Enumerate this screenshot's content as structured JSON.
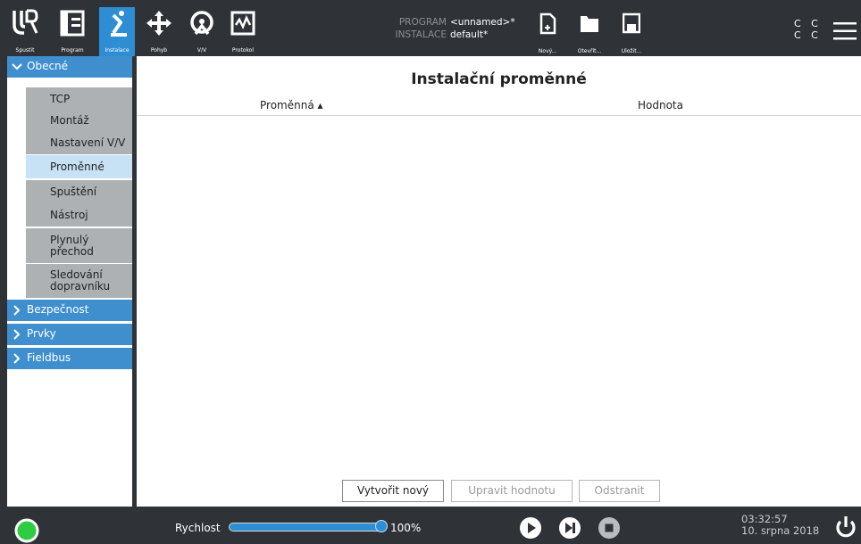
{
  "topbar": {
    "nav": [
      {
        "label": "Spustit",
        "icon": "ur-logo-icon"
      },
      {
        "label": "Program",
        "icon": "program-icon"
      },
      {
        "label": "Instalace",
        "icon": "installation-icon",
        "active": true
      },
      {
        "label": "Pohyb",
        "icon": "move-icon"
      },
      {
        "label": "V/V",
        "icon": "io-icon"
      },
      {
        "label": "Protokol",
        "icon": "log-icon"
      }
    ],
    "program_key": "PROGRAM",
    "program_value": "<unnamed>*",
    "installation_key": "INSTALACE",
    "installation_value": "default*",
    "file_buttons": [
      {
        "label": "Nový...",
        "icon": "new-file-icon"
      },
      {
        "label": "Otevřít...",
        "icon": "folder-icon"
      },
      {
        "label": "Uložit...",
        "icon": "save-icon"
      }
    ],
    "cc_top": "C C",
    "cc_bottom": "C C"
  },
  "sidebar": {
    "sections": [
      {
        "label": "Obecné",
        "expanded": true
      },
      {
        "label": "Bezpečnost",
        "expanded": false
      },
      {
        "label": "Prvky",
        "expanded": false
      },
      {
        "label": "Fieldbus",
        "expanded": false
      }
    ],
    "items": [
      {
        "label": "TCP"
      },
      {
        "label": "Montáž"
      },
      {
        "label": "Nastavení V/V"
      },
      {
        "label": "Proměnné",
        "selected": true
      },
      {
        "label": "Spuštění"
      },
      {
        "label": "Nástroj"
      },
      {
        "label": "Plynulý přechod"
      },
      {
        "label": "Sledování dopravníku"
      }
    ]
  },
  "main": {
    "title": "Instalační proměnné",
    "columns": [
      {
        "label": "Proměnná ▴"
      },
      {
        "label": "Hodnota"
      }
    ],
    "buttons": {
      "create": "Vytvořit nový",
      "edit": "Upravit hodnotu",
      "delete": "Odstranit"
    }
  },
  "bottombar": {
    "speed_label": "Rychlost",
    "speed_value": "100%",
    "speed_fraction": 1.0,
    "time": "03:32:57",
    "date": "10. srpna 2018",
    "status_color": "#2ecc40"
  },
  "colors": {
    "accent": "#2e8ed3",
    "section_bg": "#3f8fcf",
    "item_bg": "#aeb1b4",
    "item_selected_bg": "#c8e2f5",
    "chrome": "#2f3337"
  }
}
